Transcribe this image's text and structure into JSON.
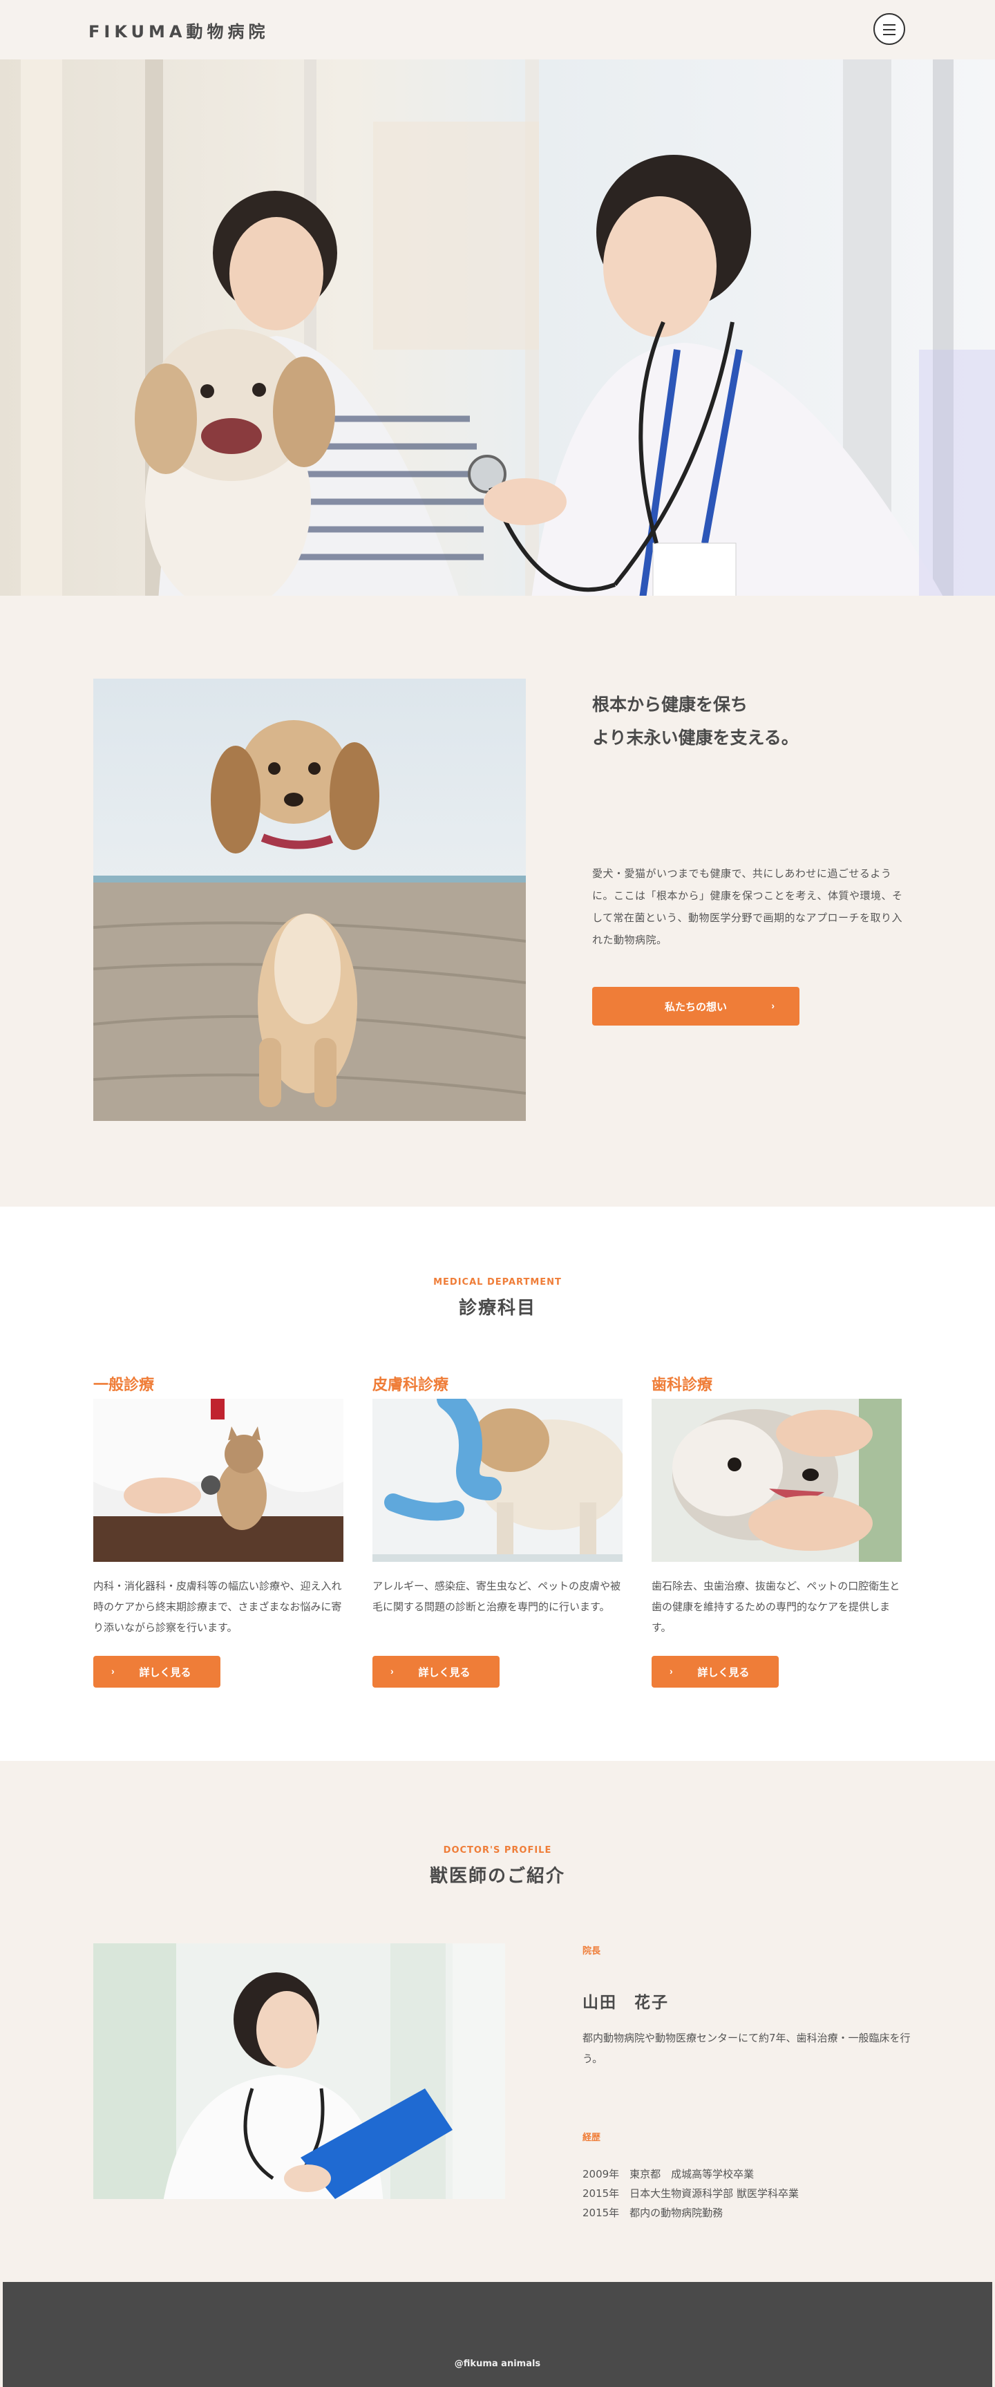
{
  "header": {
    "logo": "FIKUMA動物病院"
  },
  "intro": {
    "title_line1": "根本から健康を保ち",
    "title_line2": "より末永い健康を支える。",
    "body": "愛犬・愛猫がいつまでも健康で、共にしあわせに過ごせるように。ここは「根本から」健康を保つことを考え、体質や環境、そして常在菌という、動物医学分野で画期的なアプローチを取り入れた動物病院。",
    "button_label": "私たちの想い"
  },
  "department": {
    "eyebrow": "MEDICAL DEPARTMENT",
    "title": "診療科目",
    "cards": [
      {
        "title": "一般診療",
        "text": "内科・消化器科・皮膚科等の幅広い診療や、迎え入れ時のケアから終末期診療まで、さまざまなお悩みに寄り添いながら診察を行います。",
        "button_label": "詳しく見る"
      },
      {
        "title": "皮膚科診療",
        "text": "アレルギー、感染症、寄生虫など、ペットの皮膚や被毛に関する問題の診断と治療を専門的に行います。",
        "button_label": "詳しく見る"
      },
      {
        "title": "歯科診療",
        "text": "歯石除去、虫歯治療、抜歯など、ペットの口腔衛生と歯の健康を維持するための専門的なケアを提供します。",
        "button_label": "詳しく見る"
      }
    ]
  },
  "profile": {
    "eyebrow": "DOCTOR'S PROFILE",
    "title": "獣医師のご紹介",
    "role": "院長",
    "name": "山田　花子",
    "description": "都内動物病院や動物医療センターにて約7年、歯科治療・一般臨床を行う。",
    "career_label": "経歴",
    "career": [
      "2009年　東京都　成城高等学校卒業",
      "2015年　日本大生物資源科学部 獣医学科卒業",
      "2015年　都内の動物病院勤務"
    ]
  },
  "footer": {
    "text": "@fikuma animals"
  },
  "colors": {
    "accent": "#ef7d38",
    "beige": "#f6f1ec",
    "footer": "#4a4a4a"
  }
}
